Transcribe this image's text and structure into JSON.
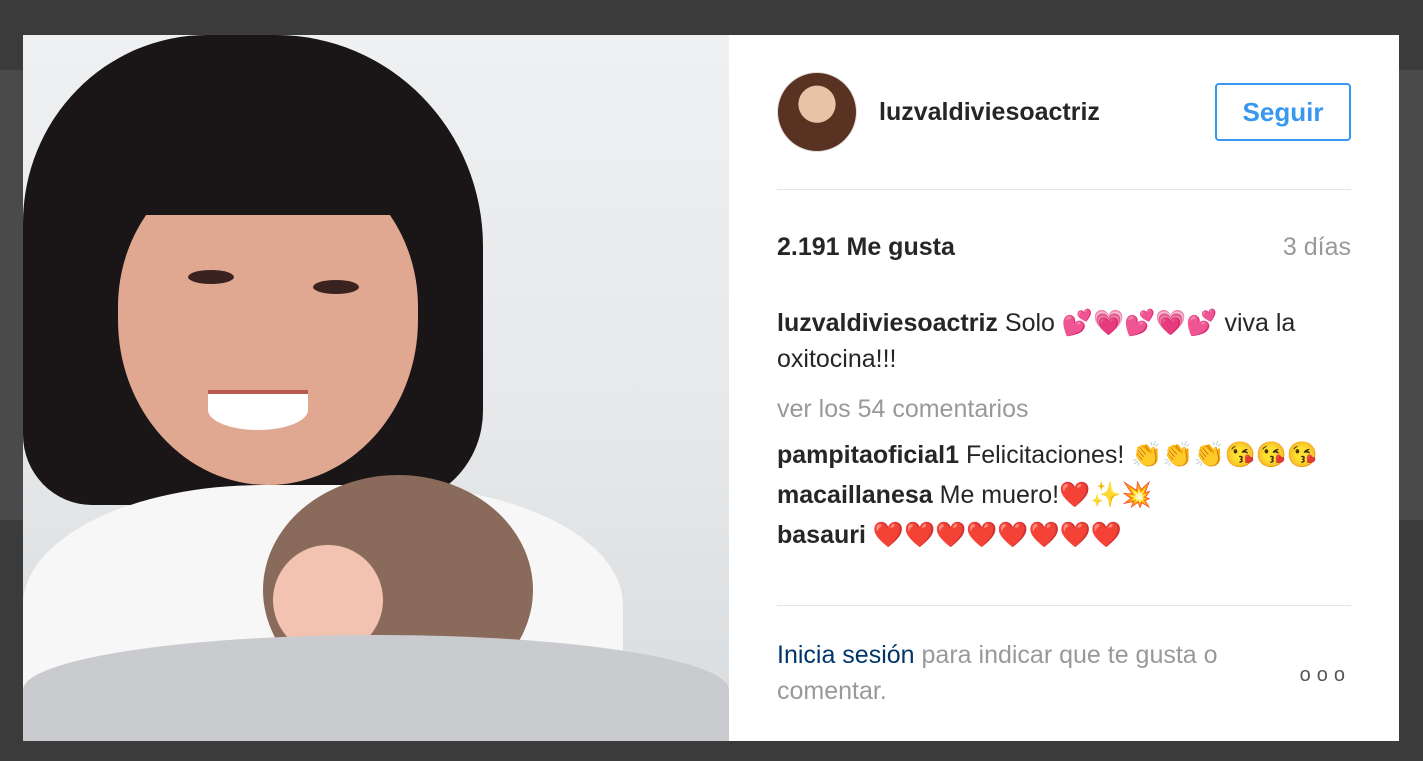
{
  "post": {
    "username": "luzvaldiviesoactriz",
    "follow_label": "Seguir",
    "likes": "2.191 Me gusta",
    "age": "3 días",
    "caption": {
      "user": "luzvaldiviesoactriz",
      "text": "Solo 💕💗💕💗💕 viva la oxitocina!!!"
    },
    "view_comments": "ver los 54 comentarios",
    "comments": [
      {
        "user": "pampitaoficial1",
        "text": "Felicitaciones! 👏👏👏😘😘😘"
      },
      {
        "user": "macaillanesa",
        "text": "Me muero!❤️✨💥"
      },
      {
        "user": "basauri",
        "text": "❤️❤️❤️❤️❤️❤️❤️❤️"
      }
    ],
    "footer": {
      "login_link": "Inicia sesión",
      "text": "para indicar que te gusta o comentar.",
      "more_label": "ooo"
    }
  },
  "colors": {
    "accent": "#3897f0",
    "link": "#003569",
    "muted": "#999999",
    "text": "#262626"
  }
}
